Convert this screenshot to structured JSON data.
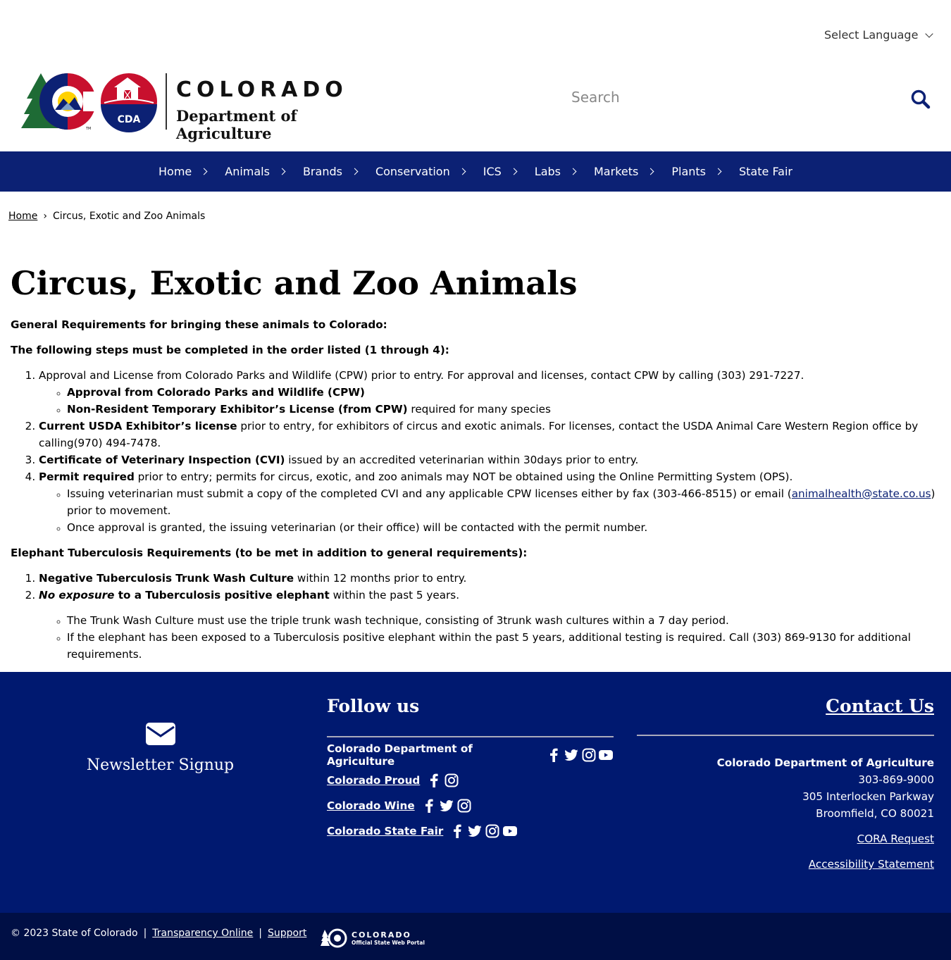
{
  "header": {
    "language_label": "Select Language",
    "logo": {
      "title": "COLORADO",
      "subtitle": "Department of Agriculture",
      "badge": "CDA",
      "tm": "TM"
    },
    "search": {
      "placeholder": "Search"
    }
  },
  "nav": {
    "items": [
      {
        "label": "Home"
      },
      {
        "label": "Animals"
      },
      {
        "label": "Brands"
      },
      {
        "label": "Conservation"
      },
      {
        "label": "ICS"
      },
      {
        "label": "Labs"
      },
      {
        "label": "Markets"
      },
      {
        "label": "Plants"
      },
      {
        "label": "State Fair"
      }
    ]
  },
  "breadcrumb": {
    "home": "Home",
    "separator": "›",
    "current": "Circus, Exotic and Zoo Animals"
  },
  "page": {
    "title": "Circus, Exotic and Zoo Animals",
    "general_heading": "General Requirements for bringing these animals to Colorado:",
    "order_heading": "The following steps must be completed in the order listed (1 through 4):",
    "step1": {
      "text": "Approval and License from Colorado Parks and Wildlife (CPW) prior to entry. For approval and licenses, contact CPW by calling (303) 291-7227.",
      "sub1": "Approval from Colorado Parks and Wildlife (CPW)",
      "sub2_bold": "Non-Resident Temporary Exhibitor’s License (from CPW)",
      "sub2_rest": " required for many species"
    },
    "step2": {
      "bold": "Current USDA Exhibitor’s license",
      "rest": " prior to entry, for exhibitors of circus and exotic animals. For licenses, contact the USDA Animal Care Western Region office by calling(970) 494-7478."
    },
    "step3": {
      "bold": "Certificate of Veterinary Inspection (CVI)",
      "rest": " issued by an accredited veterinarian within 30days prior to entry."
    },
    "step4": {
      "bold": "Permit required",
      "rest": " prior to entry; permits for circus, exotic, and zoo animals may NOT be obtained using the Online Permitting System (OPS).",
      "sub1_pre": "Issuing veterinarian must submit a copy of the completed CVI and any applicable CPW licenses either by fax (303-466-8515) or email (",
      "sub1_link": "animalhealth@state.co.us",
      "sub1_post": ") prior to movement.",
      "sub2": "Once approval is granted, the issuing veterinarian (or their office) will be contacted with the permit number."
    },
    "elephant_heading": "Elephant Tuberculosis Requirements (to be met in addition to general requirements):",
    "eleph1": {
      "bold": "Negative Tuberculosis Trunk Wash Culture",
      "rest": " within 12 months prior to entry."
    },
    "eleph2": {
      "bold_italic": "No exposure",
      "bold": " to a Tuberculosis positive elephant",
      "rest": " within the past 5 years."
    },
    "eleph_notes": [
      "The Trunk Wash Culture must use the triple trunk wash technique, consisting of 3trunk wash cultures within a 7 day period.",
      "If the elephant has been exposed to a Tuberculosis positive elephant within the past 5 years, additional testing is required. Call (303) 869-9130 for additional requirements."
    ]
  },
  "footer": {
    "newsletter": "Newsletter Signup",
    "follow_title": "Follow us",
    "social": [
      {
        "name": "Colorado Department of Agriculture",
        "icons": [
          "facebook-icon",
          "twitter-icon",
          "instagram-icon",
          "youtube-icon"
        ]
      },
      {
        "name": "Colorado Proud",
        "icons": [
          "facebook-icon",
          "instagram-icon"
        ]
      },
      {
        "name": "Colorado Wine",
        "icons": [
          "facebook-icon",
          "twitter-icon",
          "instagram-icon"
        ]
      },
      {
        "name": "Colorado State Fair",
        "icons": [
          "facebook-icon",
          "twitter-icon",
          "instagram-icon",
          "youtube-icon"
        ]
      }
    ],
    "contact_title": "Contact Us",
    "org": "Colorado Department of Agriculture",
    "phone": "303-869-9000",
    "street": "305 Interlocken Parkway",
    "city": "Broomfield, CO 80021",
    "cora": "CORA Request",
    "accessibility": "Accessibility Statement"
  },
  "bottom": {
    "copyright": "© 2023 State of Colorado",
    "sep": "|",
    "transparency": "Transparency Online",
    "support": "Support",
    "portal_title": "COLORADO",
    "portal_sub": "Official State Web Portal"
  },
  "colors": {
    "navy": "#0c2174",
    "footer": "#001970",
    "bottom": "#000f45",
    "red": "#c8102e",
    "gold": "#ffd100",
    "green": "#1e6b35"
  }
}
